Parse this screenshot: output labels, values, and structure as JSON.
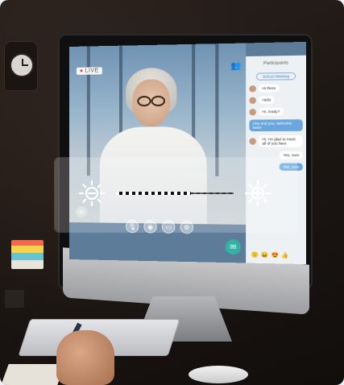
{
  "app": {
    "live_badge": "LIVE"
  },
  "chat_panel": {
    "title": "Participants",
    "tag": "School Meeting",
    "messages": [
      {
        "text": "Hi there",
        "side": "left"
      },
      {
        "text": "Hello",
        "side": "left"
      },
      {
        "text": "Hi, ready?",
        "side": "left"
      },
      {
        "text": "Hey and you, welcome here!",
        "side": "right"
      },
      {
        "text": "Hi, I'm glad to meet all of you here",
        "side": "left"
      },
      {
        "text": "Yes, sure",
        "side": "right"
      },
      {
        "text": "Yes, sure",
        "side": "right"
      }
    ]
  },
  "video_controls": {
    "icons": [
      "mic-icon",
      "camera-icon",
      "screen-share-icon",
      "settings-icon"
    ]
  },
  "brightness": {
    "decrease_icon": "brightness-decrease-icon",
    "increase_icon": "brightness-increase-icon",
    "level": 0.64
  },
  "colors": {
    "accent": "#33b3a6",
    "chat_blue": "#6aa7de",
    "live_red": "#e23b3b"
  }
}
